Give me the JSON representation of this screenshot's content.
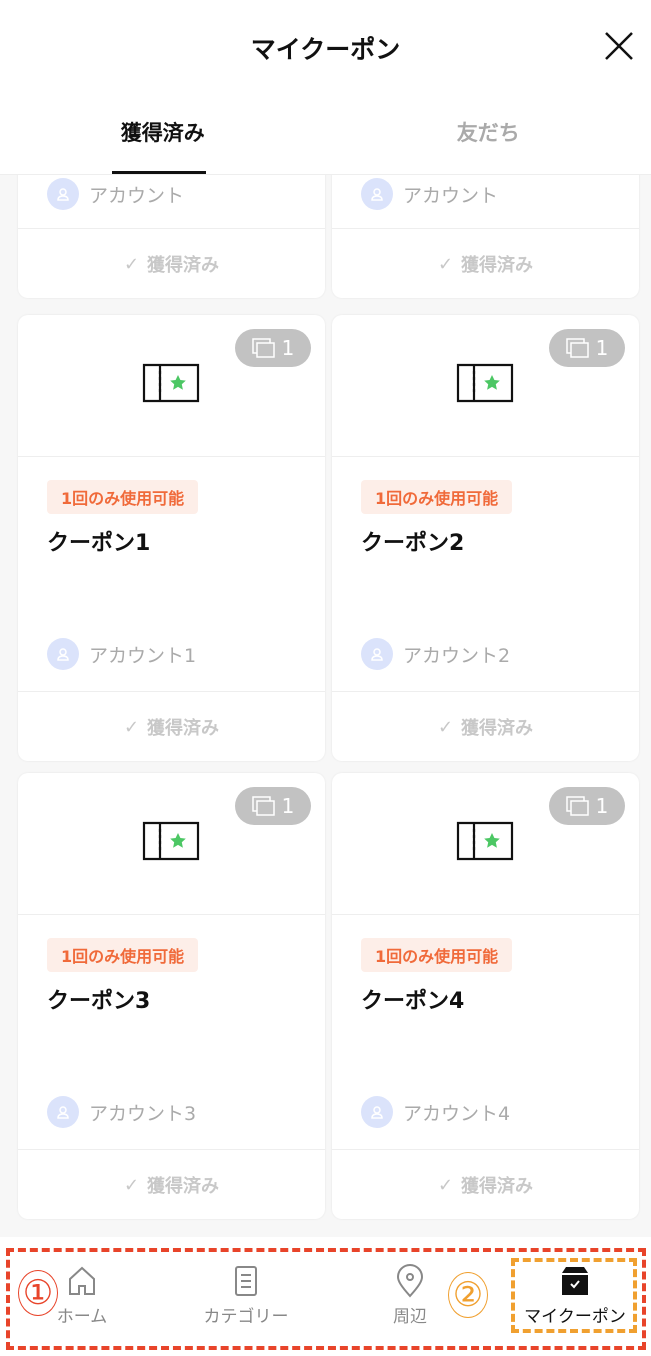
{
  "header": {
    "title": "マイクーポン",
    "close_icon": "close-icon"
  },
  "tabs": [
    {
      "label": "獲得済み",
      "active": true
    },
    {
      "label": "友だち",
      "active": false
    }
  ],
  "partial_cards": [
    {
      "account": "アカウント",
      "status": "獲得済み"
    },
    {
      "account": "アカウント",
      "status": "獲得済み"
    }
  ],
  "cards": [
    {
      "count": "1",
      "badge": "1回のみ使用可能",
      "title": "クーポン1",
      "account": "アカウント1",
      "status": "獲得済み"
    },
    {
      "count": "1",
      "badge": "1回のみ使用可能",
      "title": "クーポン2",
      "account": "アカウント2",
      "status": "獲得済み"
    },
    {
      "count": "1",
      "badge": "1回のみ使用可能",
      "title": "クーポン3",
      "account": "アカウント3",
      "status": "獲得済み"
    },
    {
      "count": "1",
      "badge": "1回のみ使用可能",
      "title": "クーポン4",
      "account": "アカウント4",
      "status": "獲得済み"
    }
  ],
  "nav": [
    {
      "label": "ホーム",
      "icon": "home-icon"
    },
    {
      "label": "カテゴリー",
      "icon": "list-icon"
    },
    {
      "label": "周辺",
      "icon": "location-pin-icon"
    },
    {
      "label": "マイクーポン",
      "icon": "coupon-box-icon",
      "active": true
    }
  ],
  "annotations": {
    "one": "①",
    "two": "②",
    "red": "#e8442a",
    "orange": "#f0a030"
  },
  "colors": {
    "badge": "#f06a3a",
    "star": "#4cc764"
  }
}
